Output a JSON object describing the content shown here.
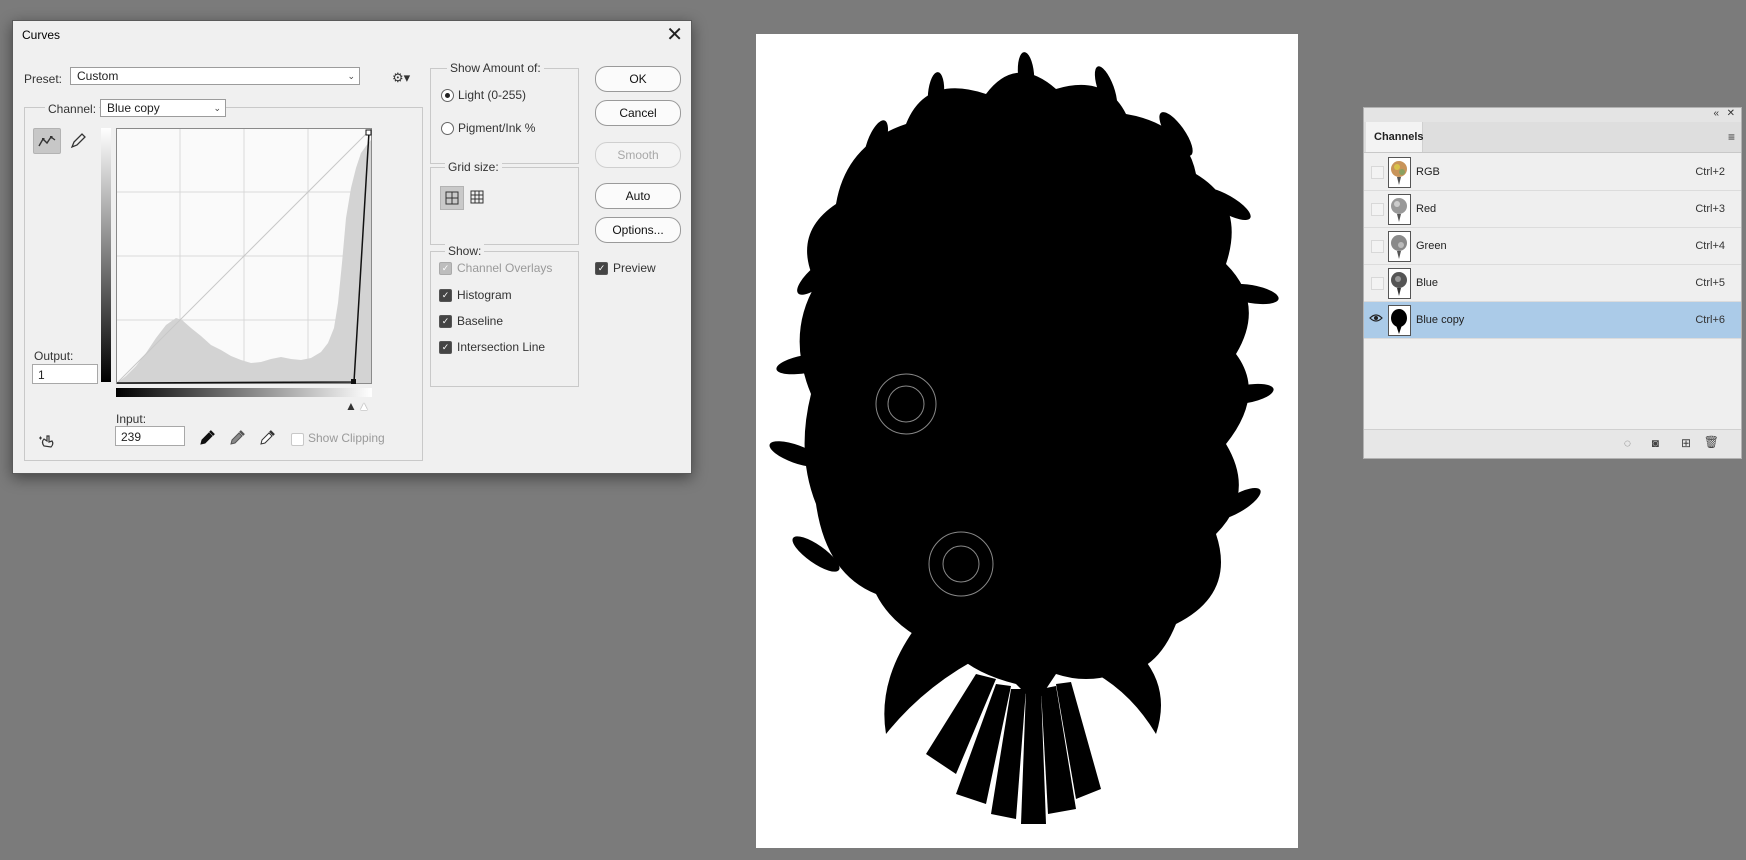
{
  "curves": {
    "title": "Curves",
    "close": "✕",
    "preset_label": "Preset:",
    "preset_value": "Custom",
    "channel_label": "Channel:",
    "channel_value": "Blue copy",
    "output_label": "Output:",
    "output_value": "1",
    "input_label": "Input:",
    "input_value": "239",
    "show_clipping": "Show Clipping",
    "show_amount_title": "Show Amount of:",
    "light_label": "Light  (0-255)",
    "pigment_label": "Pigment/Ink %",
    "grid_size_title": "Grid size:",
    "show_title": "Show:",
    "show_options": [
      {
        "label": "Channel Overlays",
        "checked": true,
        "enabled": false
      },
      {
        "label": "Histogram",
        "checked": true,
        "enabled": true
      },
      {
        "label": "Baseline",
        "checked": true,
        "enabled": true
      },
      {
        "label": "Intersection Line",
        "checked": true,
        "enabled": true
      }
    ],
    "buttons": {
      "ok": "OK",
      "cancel": "Cancel",
      "smooth": "Smooth",
      "auto": "Auto",
      "options": "Options..."
    },
    "preview_label": "Preview"
  },
  "channels_panel": {
    "tab": "Channels",
    "rows": [
      {
        "name": "RGB",
        "shortcut": "Ctrl+2",
        "selected": false
      },
      {
        "name": "Red",
        "shortcut": "Ctrl+3",
        "selected": false
      },
      {
        "name": "Green",
        "shortcut": "Ctrl+4",
        "selected": false
      },
      {
        "name": "Blue",
        "shortcut": "Ctrl+5",
        "selected": false
      },
      {
        "name": "Blue copy",
        "shortcut": "Ctrl+6",
        "selected": true
      }
    ]
  },
  "colors": {
    "workspace": "#7b7b7b",
    "selection": "#abcbe8"
  }
}
